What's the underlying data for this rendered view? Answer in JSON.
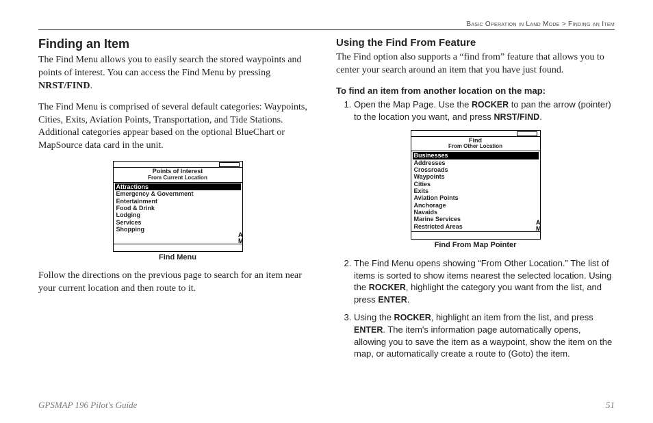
{
  "header": {
    "breadcrumb": [
      "Basic Operation in Land Mode",
      "Finding an Item"
    ]
  },
  "left": {
    "heading": "Finding an Item",
    "p1a": "The Find Menu allows you to easily search the stored waypoints and points of interest. You can access the Find Menu by pressing ",
    "key1": "NRST/FIND",
    "p1b": ".",
    "p2": "The Find Menu is comprised of several default categories: Waypoints, Cities, Exits, Aviation Points, Transportation, and Tide Stations. Additional categories appear based on the optional BlueChart or MapSource data card in the unit.",
    "screen": {
      "title": "Points of Interest",
      "subtitle": "From Current Location",
      "items": [
        "Attractions",
        "Emergency & Government",
        "Entertainment",
        "Food & Drink",
        "Lodging",
        "Services",
        "Shopping"
      ],
      "caption": "Find Menu"
    },
    "p3": "Follow the directions on the previous page to search for an item near your current location and then route to it."
  },
  "right": {
    "heading": "Using the Find From Feature",
    "p1": "The Find option also supports a “find from” feature that allows you to center your search around an item that you have just found.",
    "procedure_title": "To find an item from another location on the map:",
    "screen": {
      "title": "Find",
      "subtitle": "From Other Location",
      "items": [
        "Businesses",
        "Addresses",
        "Crossroads",
        "Waypoints",
        "Cities",
        "Exits",
        "Aviation Points",
        "Anchorage",
        "Navaids",
        "Marine Services",
        "Restricted Areas"
      ],
      "caption": "Find From Map Pointer"
    },
    "steps": [
      {
        "a": "Open the Map Page. Use the ",
        "k1": "ROCKER",
        "b": " to pan the arrow (pointer) to the location you want, and press ",
        "k2": "NRST/FIND",
        "c": "."
      },
      {
        "a": "The Find Menu opens showing “From Other Location.” The list of items is sorted to show items nearest the selected location. Using the ",
        "k1": "ROCKER",
        "b": ", highlight the category you want from the list, and press ",
        "k2": "ENTER",
        "c": "."
      },
      {
        "a": "Using the ",
        "k1": "ROCKER",
        "b": ", highlight an item from the list, and press ",
        "k2": "ENTER",
        "c": ". The item's information page automatically opens, allowing you to save the item as a waypoint, show the item on the map, or automatically create a route to (Goto) the item."
      }
    ]
  },
  "footer": {
    "title": "GPSMAP 196 Pilot's Guide",
    "page": "51"
  }
}
